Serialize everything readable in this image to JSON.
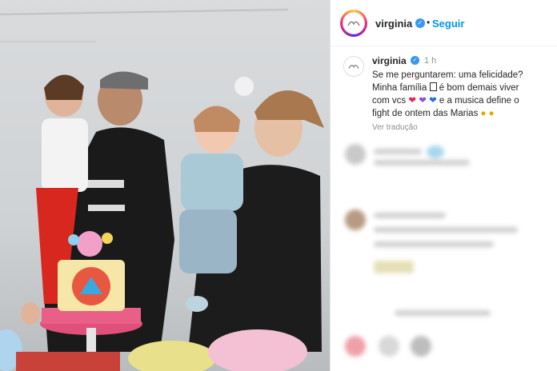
{
  "header": {
    "username": "virginia",
    "follow_label": "Seguir",
    "separator": "•"
  },
  "caption": {
    "username": "virginia",
    "time": "1 h",
    "line1": "Se me perguntarem: uma felicidade?",
    "line2a": "Minha família ",
    "line2b": " é bom demais viver",
    "line3a": "com vcs ",
    "line3b": " e a musica define o",
    "line4": "fight de ontem das Marias ",
    "see_translation": "Ver tradução"
  },
  "icons": {
    "verified": "verified-badge-icon",
    "house": "house-emoji-icon",
    "hearts": [
      "red-heart",
      "purple-heart",
      "blue-heart"
    ],
    "laugh": "rolling-laughing-emoji"
  },
  "colors": {
    "follow": "#0095f6",
    "verified": "#3897f0"
  }
}
